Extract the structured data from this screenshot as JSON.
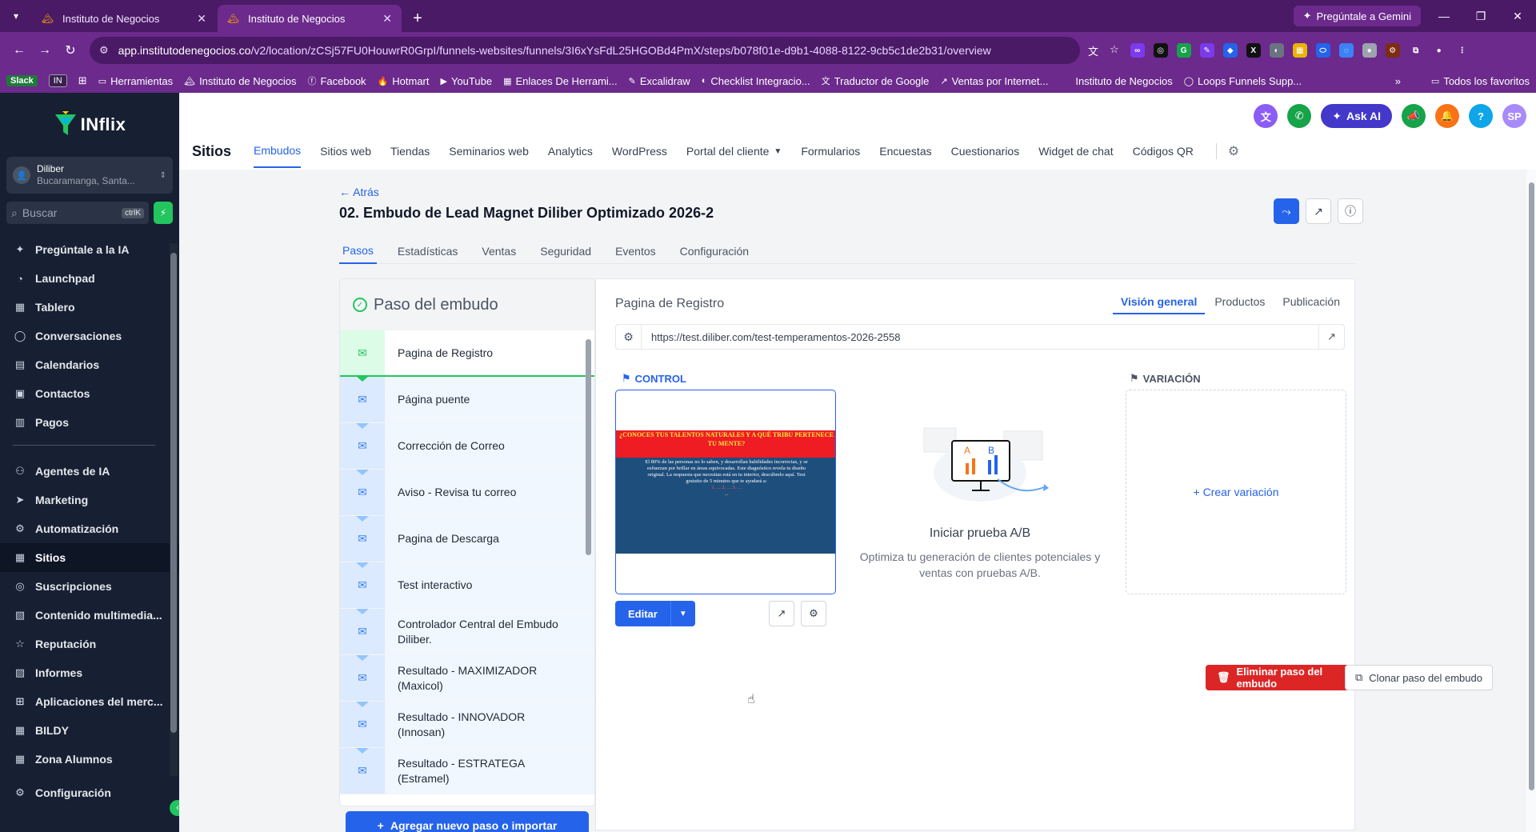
{
  "browser": {
    "tabs": [
      {
        "label": "Instituto de Negocios",
        "active": false
      },
      {
        "label": "Instituto de Negocios",
        "active": true
      }
    ],
    "gemini_label": "Pregúntale a Gemini",
    "url_host": "app.institutodenegocios.co",
    "url_path": "/v2/location/zCSj57FU0HouwrR0GrpI/funnels-websites/funnels/3I6xYsFdL25HGOBd4PmX/steps/b078f01e-d9b1-4088-8122-9cb5c1de2b31/overview",
    "bookmarks": [
      {
        "label": "Herramientas",
        "icon": "folder-icon"
      },
      {
        "label": "Instituto de Negocios",
        "icon": "site-icon"
      },
      {
        "label": "Facebook",
        "icon": "facebook-icon"
      },
      {
        "label": "Hotmart",
        "icon": "hotmart-icon"
      },
      {
        "label": "YouTube",
        "icon": "youtube-icon"
      },
      {
        "label": "Enlaces De Herrami...",
        "icon": "sheets-icon"
      },
      {
        "label": "Excalidraw",
        "icon": "excalidraw-icon"
      },
      {
        "label": "Checklist Integracio...",
        "icon": "checklist-icon"
      },
      {
        "label": "Traductor de Google",
        "icon": "translate-icon"
      },
      {
        "label": "Ventas por Internet...",
        "icon": "link-icon"
      },
      {
        "label": "Instituto de Negocios",
        "icon": "site-icon"
      },
      {
        "label": "Loops Funnels Supp...",
        "icon": "loops-icon"
      }
    ],
    "bookmarks_chips": [
      "Slack",
      "IN"
    ],
    "all_bookmarks": "Todos los favoritos"
  },
  "sidebar": {
    "brand": "INflix",
    "location_name": "Diliber",
    "location_sub": "Bucaramanga, Santa...",
    "search_placeholder": "Buscar",
    "search_kbd": "ctrlK",
    "items_top": [
      {
        "label": "Pregúntale a la IA",
        "icon": "sparkle-icon"
      },
      {
        "label": "Launchpad",
        "icon": "launchpad-icon"
      },
      {
        "label": "Tablero",
        "icon": "dashboard-icon"
      },
      {
        "label": "Conversaciones",
        "icon": "chat-icon"
      },
      {
        "label": "Calendarios",
        "icon": "calendar-icon"
      },
      {
        "label": "Contactos",
        "icon": "contacts-icon"
      },
      {
        "label": "Pagos",
        "icon": "payments-icon"
      }
    ],
    "items_bottom": [
      {
        "label": "Agentes de IA",
        "icon": "ai-agents-icon"
      },
      {
        "label": "Marketing",
        "icon": "marketing-icon"
      },
      {
        "label": "Automatización",
        "icon": "automation-icon"
      },
      {
        "label": "Sitios",
        "icon": "sites-icon",
        "active": true
      },
      {
        "label": "Suscripciones",
        "icon": "subscriptions-icon"
      },
      {
        "label": "Contenido multimedia...",
        "icon": "media-icon"
      },
      {
        "label": "Reputación",
        "icon": "star-icon"
      },
      {
        "label": "Informes",
        "icon": "reports-icon"
      },
      {
        "label": "Aplicaciones del merc...",
        "icon": "apps-icon"
      },
      {
        "label": "BILDY",
        "icon": "bildy-icon"
      },
      {
        "label": "Zona Alumnos",
        "icon": "graduation-icon"
      },
      {
        "label": "Configuración",
        "icon": "settings-icon"
      }
    ]
  },
  "header": {
    "section": "Sitios",
    "askai": "Ask AI",
    "avatar": "SP",
    "nav": [
      "Embudos",
      "Sitios web",
      "Tiendas",
      "Seminarios web",
      "Analytics",
      "WordPress",
      "Portal del cliente",
      "Formularios",
      "Encuestas",
      "Cuestionarios",
      "Widget de chat",
      "Códigos QR"
    ]
  },
  "page": {
    "back": "← Atrás",
    "title": "02. Embudo de Lead Magnet Diliber Optimizado 2026-2",
    "tabs": [
      "Pasos",
      "Estadísticas",
      "Ventas",
      "Seguridad",
      "Eventos",
      "Configuración"
    ],
    "steps_title": "Paso del embudo",
    "steps": [
      "Pagina de Registro",
      "Página puente",
      "Corrección de Correo",
      "Aviso - Revisa tu correo",
      "Pagina de Descarga",
      "Test interactivo",
      "Controlador Central del Embudo Diliber.",
      "Resultado - MAXIMIZADOR (Maxicol)",
      "Resultado - INNOVADOR (Innosan)",
      "Resultado - ESTRATEGA (Estramel)"
    ],
    "add_step": "Agregar nuevo paso o importar"
  },
  "detail": {
    "title": "Pagina de Registro",
    "tabs": [
      "Visión general",
      "Productos",
      "Publicación"
    ],
    "url": "https://test.diliber.com/test-temperamentos-2026-2558",
    "control_label": "CONTROL",
    "variation_label": "VARIACIÓN",
    "preview": {
      "headline": "¿CONOCES TUS TALENTOS NATURALES Y A QUÉ TRIBU PERTENECE TU MENTE?",
      "body": "El 80% de las personas no lo saben, y desarrollan habilidades incorrectas, y se esfuerzan por brillar en áreas equivocadas. Este diagnóstico revela tu diseño original. La respuesta que necesitas está en tu interior, descúbrelo aquí. Test gratuito de 5 minutos que te ayudará a:",
      "list": "1. ... 2. ... 3. ...",
      "footer": "..."
    },
    "edit": "Editar",
    "ab_title": "Iniciar prueba A/B",
    "ab_sub": "Optimiza tu generación de clientes potenciales y ventas con pruebas A/B.",
    "create_variation": "+ Crear variación",
    "delete": "Eliminar paso del embudo",
    "clone": "Clonar paso del embudo"
  }
}
